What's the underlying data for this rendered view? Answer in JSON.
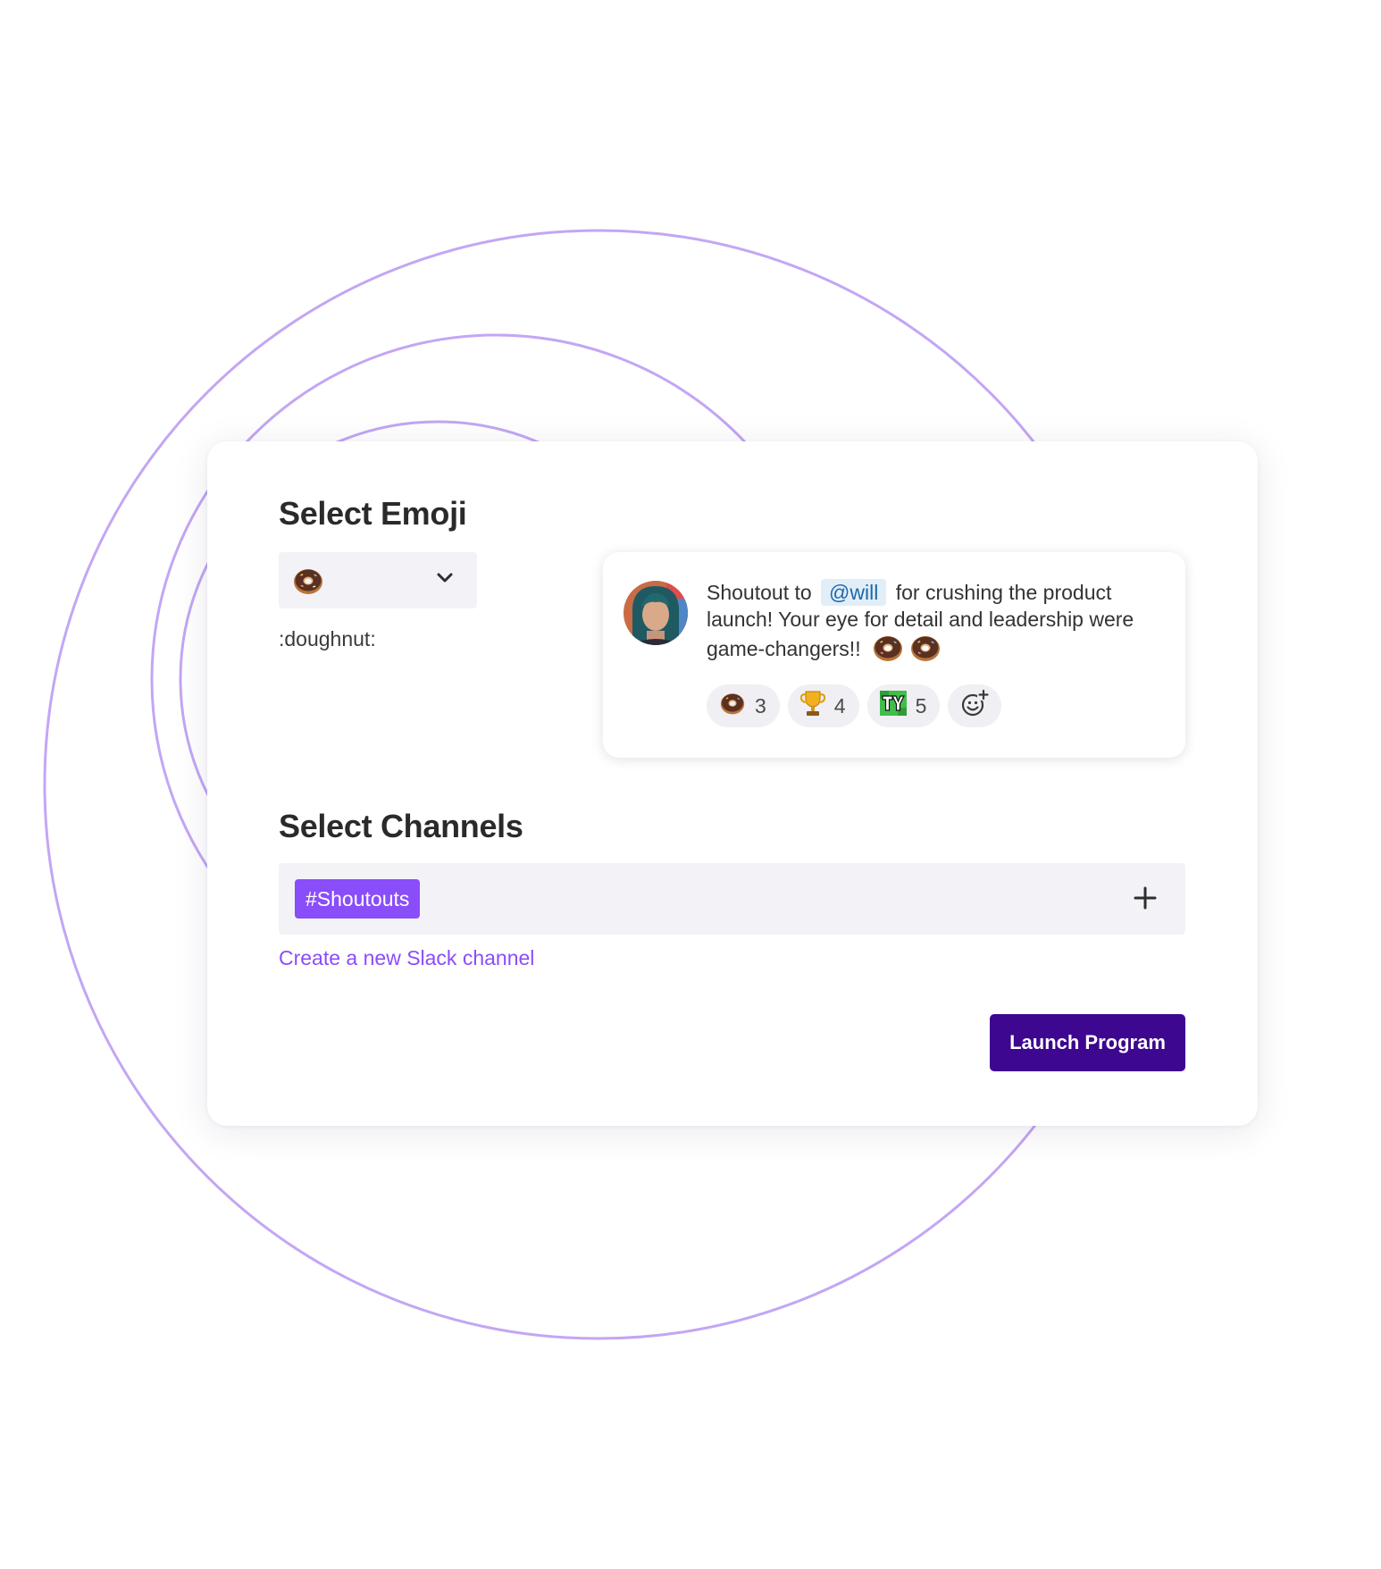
{
  "accent_color": "#8a4dfa",
  "primary_button_color": "#3d078f",
  "circle_color": "#c3a6f5",
  "emoji_section": {
    "title": "Select Emoji",
    "selected_icon": "doughnut-emoji",
    "emoji_code": ":doughnut:"
  },
  "preview": {
    "text_before": "Shoutout to",
    "mention": "@will",
    "text_after": "for crushing the product launch! Your eye for detail and leadership were game-changers!!",
    "reactions": [
      {
        "icon": "doughnut-emoji",
        "count": "3"
      },
      {
        "icon": "trophy-emoji",
        "count": "4"
      },
      {
        "icon": "ty-emoji",
        "count": "5"
      }
    ],
    "add_reaction_icon": "add-reaction-icon"
  },
  "channels_section": {
    "title": "Select Channels",
    "selected_channel": "#Shoutouts",
    "create_link": "Create a new Slack channel"
  },
  "launch_button": "Launch Program"
}
